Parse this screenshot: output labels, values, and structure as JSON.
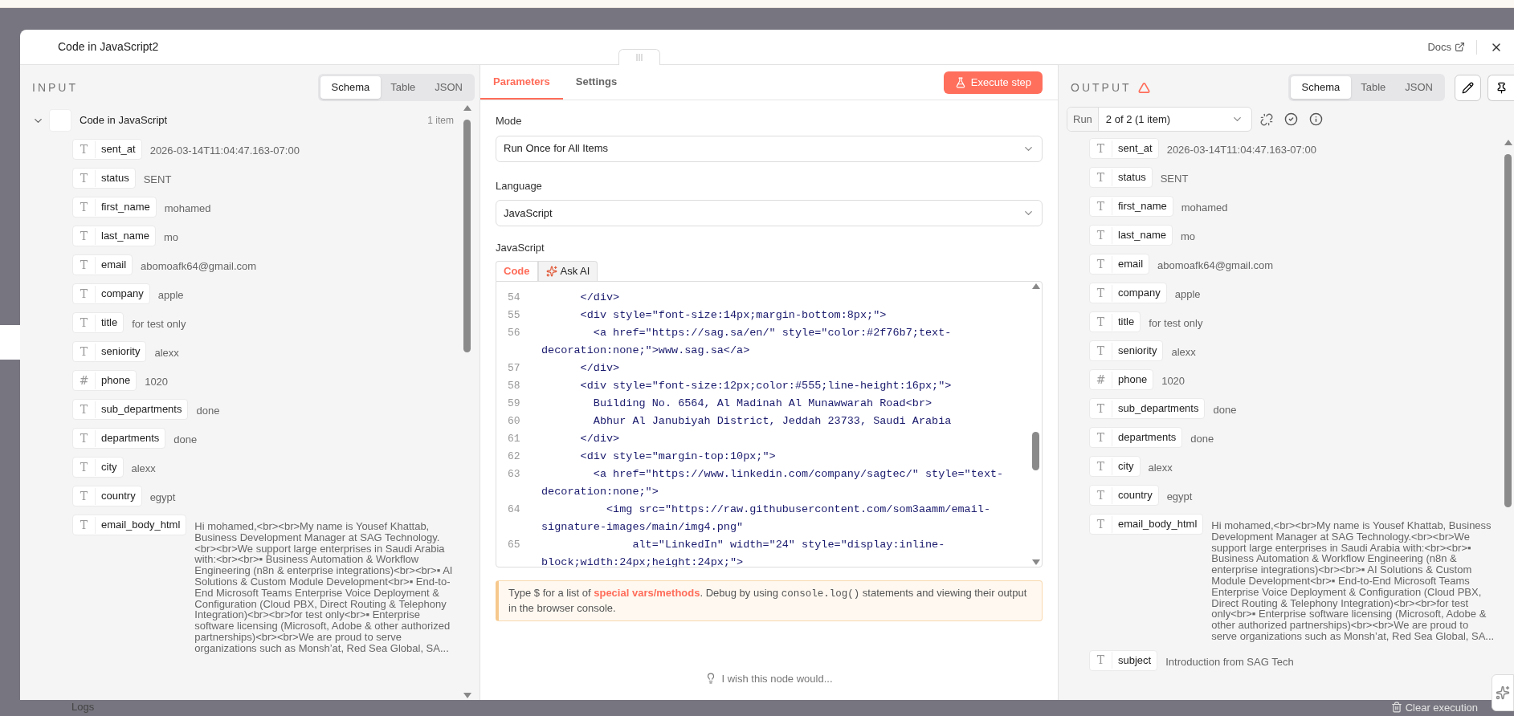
{
  "window": {
    "title": "Code in JavaScript2",
    "docs_link": "Docs"
  },
  "input": {
    "heading": "INPUT",
    "view_tabs": [
      {
        "label": "Schema",
        "selected": true
      },
      {
        "label": "Table",
        "selected": false
      },
      {
        "label": "JSON",
        "selected": false
      }
    ],
    "node": {
      "name": "Code in JavaScript",
      "count": "1 item",
      "expanded": true
    },
    "fields": [
      {
        "type_glyph": "T",
        "key": "sent_at",
        "value": "2026-03-14T11:04:47.163-07:00"
      },
      {
        "type_glyph": "T",
        "key": "status",
        "value": "SENT"
      },
      {
        "type_glyph": "T",
        "key": "first_name",
        "value": "mohamed"
      },
      {
        "type_glyph": "T",
        "key": "last_name",
        "value": "mo"
      },
      {
        "type_glyph": "T",
        "key": "email",
        "value": "abomoafk64@gmail.com"
      },
      {
        "type_glyph": "T",
        "key": "company",
        "value": "apple"
      },
      {
        "type_glyph": "T",
        "key": "title",
        "value": "for test only"
      },
      {
        "type_glyph": "T",
        "key": "seniority",
        "value": "alexx"
      },
      {
        "type_glyph": "#",
        "key": "phone",
        "value": "1020"
      },
      {
        "type_glyph": "T",
        "key": "sub_departments",
        "value": "done"
      },
      {
        "type_glyph": "T",
        "key": "departments",
        "value": "done"
      },
      {
        "type_glyph": "T",
        "key": "city",
        "value": "alexx"
      },
      {
        "type_glyph": "T",
        "key": "country",
        "value": "egypt"
      },
      {
        "type_glyph": "T",
        "key": "email_body_html",
        "value": "Hi mohamed,<br><br>My name is Yousef Khattab, Business Development Manager at SAG Technology.<br><br>We support large enterprises in Saudi Arabia with:<br><br>▪ Business Automation & Workflow Engineering (n8n & enterprise integrations)<br><br>▪ AI Solutions & Custom Module Development<br>▪ End-to-End Microsoft Teams Enterprise Voice Deployment & Configuration (Cloud PBX, Direct Routing & Telephony Integration)<br><br>for test only<br>▪ Enterprise software licensing (Microsoft, Adobe & other authorized partnerships)<br><br>We are proud to serve organizations such as Monsh’at, Red Sea Global, SA..."
      }
    ]
  },
  "parameters": {
    "tabs": [
      {
        "label": "Parameters",
        "selected": true
      },
      {
        "label": "Settings",
        "selected": false
      }
    ],
    "execute_button": "Execute step",
    "mode": {
      "label": "Mode",
      "value": "Run Once for All Items"
    },
    "language": {
      "label": "Language",
      "value": "JavaScript"
    },
    "editor": {
      "label": "JavaScript",
      "tabs": [
        {
          "label": "Code",
          "selected": true
        },
        {
          "label": "Ask AI",
          "selected": false
        }
      ],
      "lines": [
        {
          "number": "54",
          "text": [
            "      </div>"
          ]
        },
        {
          "number": "55",
          "text": [
            "      <div style=\"font-size:14px;margin-bottom:8px;\">"
          ]
        },
        {
          "number": "56",
          "text": [
            "        <a href=\"https://sag.sa/en/\" style=\"color:#2f76b7;text-",
            "decoration:none;\">www.sag.sa</a>"
          ]
        },
        {
          "number": "57",
          "text": [
            "      </div>"
          ]
        },
        {
          "number": "58",
          "text": [
            "      <div style=\"font-size:12px;color:#555;line-height:16px;\">"
          ]
        },
        {
          "number": "59",
          "text": [
            "        Building No. 6564, Al Madinah Al Munawwarah Road<br>"
          ]
        },
        {
          "number": "60",
          "text": [
            "        Abhur Al Janubiyah District, Jeddah 23733, Saudi Arabia"
          ]
        },
        {
          "number": "61",
          "text": [
            "      </div>"
          ]
        },
        {
          "number": "62",
          "text": [
            "      <div style=\"margin-top:10px;\">"
          ]
        },
        {
          "number": "63",
          "text": [
            "        <a href=\"https://www.linkedin.com/company/sagtec/\" style=\"text-",
            "decoration:none;\">"
          ]
        },
        {
          "number": "64",
          "text": [
            "          <img src=\"https://raw.githubusercontent.com/som3aamm/email-",
            "signature-images/main/img4.png\""
          ]
        },
        {
          "number": "65",
          "text": [
            "              alt=\"LinkedIn\" width=\"24\" style=\"display:inline-",
            "block;width:24px;height:24px;\">"
          ]
        }
      ]
    },
    "hint": {
      "before": "Type $ for a list of ",
      "link": "special vars/methods",
      "middle": ". Debug by using ",
      "code": "console.log()",
      "after": " statements and viewing their output in the browser console."
    },
    "feedback": "I wish this node would..."
  },
  "output": {
    "heading": "OUTPUT",
    "warning": true,
    "view_tabs": [
      {
        "label": "Schema",
        "selected": true
      },
      {
        "label": "Table",
        "selected": false
      },
      {
        "label": "JSON",
        "selected": false
      }
    ],
    "run_label": "Run",
    "run_value": "2 of 2 (1 item)",
    "fields": [
      {
        "type_glyph": "T",
        "key": "sent_at",
        "value": "2026-03-14T11:04:47.163-07:00"
      },
      {
        "type_glyph": "T",
        "key": "status",
        "value": "SENT"
      },
      {
        "type_glyph": "T",
        "key": "first_name",
        "value": "mohamed"
      },
      {
        "type_glyph": "T",
        "key": "last_name",
        "value": "mo"
      },
      {
        "type_glyph": "T",
        "key": "email",
        "value": "abomoafk64@gmail.com"
      },
      {
        "type_glyph": "T",
        "key": "company",
        "value": "apple"
      },
      {
        "type_glyph": "T",
        "key": "title",
        "value": "for test only"
      },
      {
        "type_glyph": "T",
        "key": "seniority",
        "value": "alexx"
      },
      {
        "type_glyph": "#",
        "key": "phone",
        "value": "1020"
      },
      {
        "type_glyph": "T",
        "key": "sub_departments",
        "value": "done"
      },
      {
        "type_glyph": "T",
        "key": "departments",
        "value": "done"
      },
      {
        "type_glyph": "T",
        "key": "city",
        "value": "alexx"
      },
      {
        "type_glyph": "T",
        "key": "country",
        "value": "egypt"
      },
      {
        "type_glyph": "T",
        "key": "email_body_html",
        "value": "Hi mohamed,<br><br>My name is Yousef Khattab, Business Development Manager at SAG Technology.<br><br>We support large enterprises in Saudi Arabia with:<br><br>▪ Business Automation & Workflow Engineering (n8n & enterprise integrations)<br><br>▪ AI Solutions & Custom Module Development<br>▪ End-to-End Microsoft Teams Enterprise Voice Deployment & Configuration (Cloud PBX, Direct Routing & Telephony Integration)<br><br>for test only<br>▪ Enterprise software licensing (Microsoft, Adobe & other authorized partnerships)<br><br>We are proud to serve organizations such as Monsh’at, Red Sea Global, SA..."
      },
      {
        "type_glyph": "T",
        "key": "subject",
        "value": "Introduction from SAG Tech"
      }
    ]
  },
  "canvas": {
    "logs_label": "Logs",
    "clear_button": "Clear execution"
  }
}
